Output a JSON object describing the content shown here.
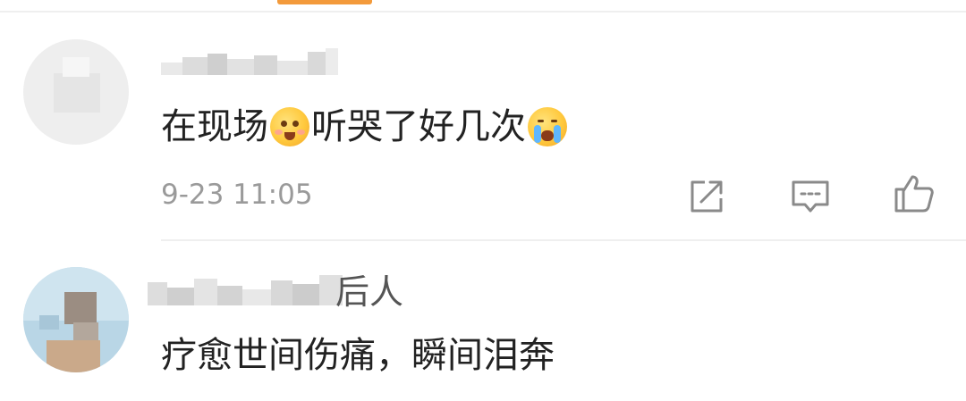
{
  "comments": [
    {
      "text_parts": [
        "在现场",
        "听哭了好几次",
        ""
      ],
      "emojis": [
        "blush-emoji",
        "crying-emoji"
      ],
      "timestamp": "9-23 11:05",
      "actions": [
        "share-icon",
        "comment-icon",
        "like-icon"
      ]
    },
    {
      "author_tail": "后人",
      "text": "疗愈世间伤痛，瞬间泪奔"
    }
  ],
  "colors": {
    "accent": "#f39a3b",
    "text_primary": "#222222",
    "text_secondary": "#9a9a9a",
    "icon": "#8a8a8a",
    "divider": "#efefef"
  }
}
